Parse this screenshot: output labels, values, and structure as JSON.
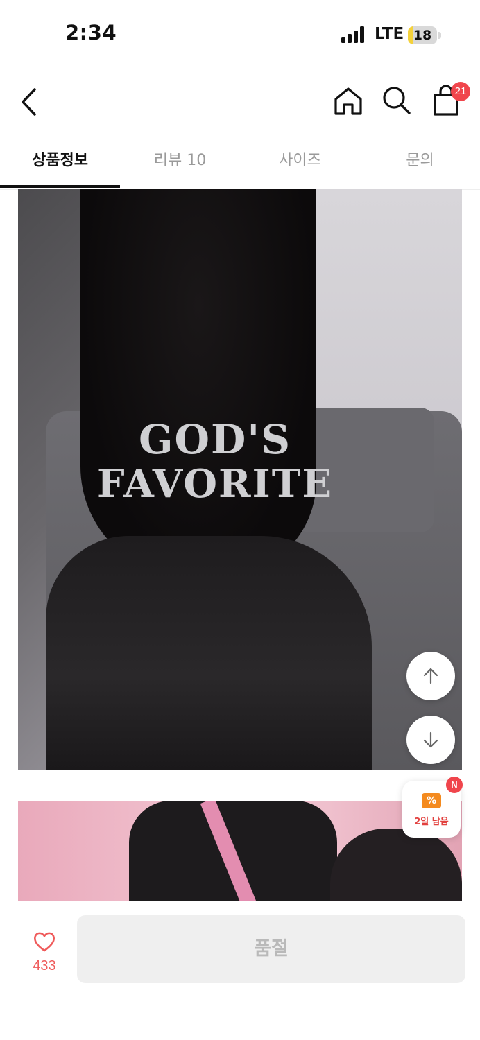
{
  "status_bar": {
    "time": "2:34",
    "network": "LTE",
    "battery": "18",
    "battery_level": 0.18
  },
  "header": {
    "back_icon": "chevron-left-icon",
    "home_icon": "home-icon",
    "search_icon": "search-icon",
    "cart_icon": "shopping-bag-icon",
    "cart_count": "21"
  },
  "tabs": [
    {
      "label": "상품정보",
      "active": true
    },
    {
      "label": "리뷰 10",
      "active": false
    },
    {
      "label": "사이즈",
      "active": false
    },
    {
      "label": "문의",
      "active": false
    }
  ],
  "product_image": {
    "shirt_text_line1": "GOD'S",
    "shirt_text_line2": "FAVORITE"
  },
  "scroll_buttons": {
    "up_icon": "arrow-up-icon",
    "down_icon": "arrow-down-icon"
  },
  "coupon": {
    "icon": "coupon-icon",
    "symbol": "%",
    "label": "2일 남음",
    "new_badge": "N"
  },
  "bottom_bar": {
    "like_icon": "heart-icon",
    "like_count": "433",
    "soldout_label": "품절"
  },
  "colors": {
    "accent_red": "#f0454c",
    "like_red": "#ef5a5a",
    "coupon_orange": "#f48a1e",
    "battery_yellow": "#f5d23a"
  }
}
